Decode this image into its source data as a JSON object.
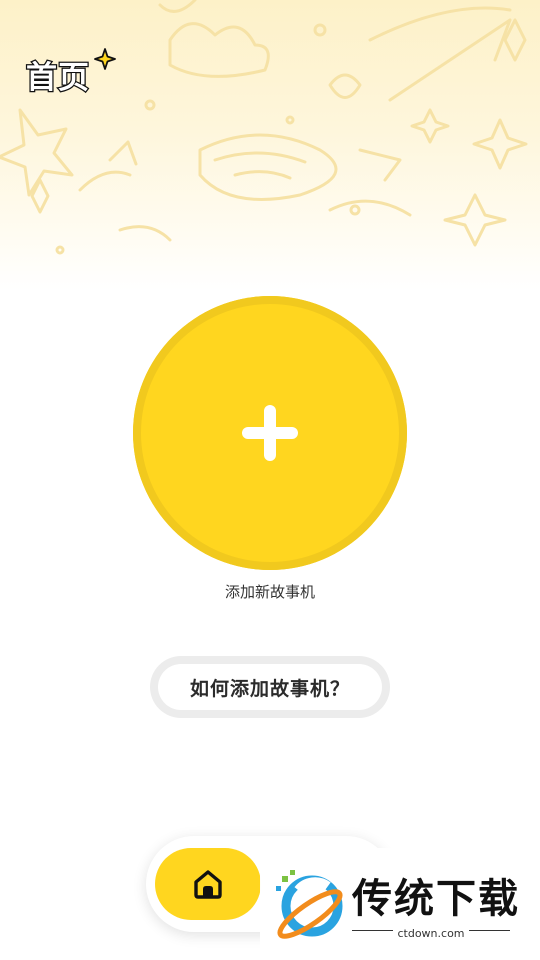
{
  "header": {
    "title": "首页"
  },
  "main": {
    "add_story_label": "添加新故事机",
    "help_button_label": "如何添加故事机？"
  },
  "bottom_nav": {
    "active_tab": "home",
    "tabs": [
      {
        "icon": "home-icon"
      }
    ]
  },
  "watermark": {
    "brand": "传统下载",
    "url": "ctdown.com"
  },
  "colors": {
    "accent_yellow": "#ffd61f",
    "accent_yellow_ring": "#f1c91e",
    "header_tint": "#fdf1c8",
    "help_ring": "#ececec"
  }
}
